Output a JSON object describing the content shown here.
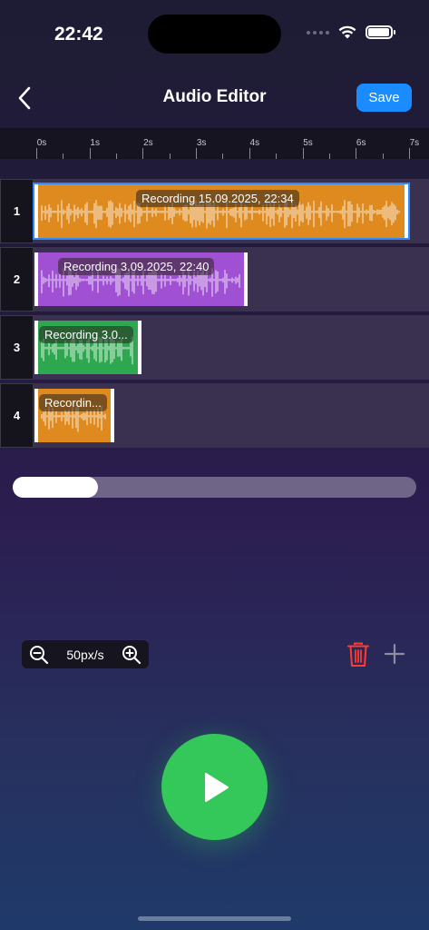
{
  "status_bar": {
    "time": "22:42"
  },
  "nav": {
    "title": "Audio Editor",
    "save_label": "Save"
  },
  "ruler": {
    "labels": [
      "0s",
      "1s",
      "2s",
      "3s",
      "4s",
      "5s",
      "6s",
      "7s"
    ]
  },
  "tracks": [
    {
      "number": "1",
      "clip_label": "Recording 15.09.2025, 22:34",
      "color": "#de8a1f",
      "selected": true
    },
    {
      "number": "2",
      "clip_label": "Recording 3.09.2025, 22:40",
      "color": "#a050d2",
      "selected": false
    },
    {
      "number": "3",
      "clip_label": "Recording 3.0...",
      "color": "#2ea850",
      "selected": false
    },
    {
      "number": "4",
      "clip_label": "Recordin...",
      "color": "#de8a1f",
      "selected": false
    }
  ],
  "zoom": {
    "label": "50px/s"
  },
  "colors": {
    "accent": "#1a8cff",
    "play": "#34c759",
    "delete": "#ff3b30"
  },
  "icons": {
    "back": "chevron-left-icon",
    "zoom_out": "zoom-out-icon",
    "zoom_in": "zoom-in-icon",
    "delete": "trash-icon",
    "add": "plus-icon",
    "play": "play-icon"
  }
}
